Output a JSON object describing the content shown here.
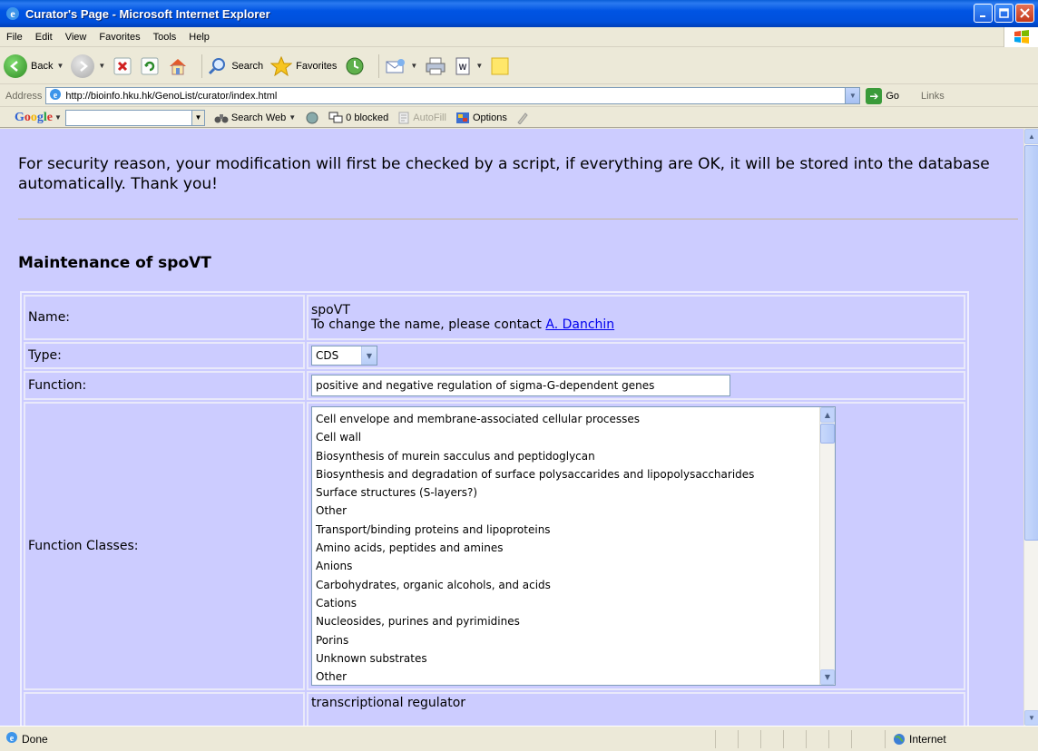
{
  "window": {
    "title": "Curator's Page - Microsoft Internet Explorer"
  },
  "menu": [
    {
      "label": "File"
    },
    {
      "label": "Edit"
    },
    {
      "label": "View"
    },
    {
      "label": "Favorites"
    },
    {
      "label": "Tools"
    },
    {
      "label": "Help"
    }
  ],
  "toolbar": {
    "back_label": "Back",
    "search_label": "Search",
    "favorites_label": "Favorites"
  },
  "address": {
    "label": "Address",
    "url": "http://bioinfo.hku.hk/GenoList/curator/index.html",
    "go_label": "Go",
    "links_label": "Links"
  },
  "google": {
    "logo": "Google",
    "search_web_label": "Search Web",
    "blocked_label": "0 blocked",
    "autofill_label": "AutoFill",
    "options_label": "Options"
  },
  "content": {
    "notice": "For security reason, your modification will first be checked by a script, if everything are OK, it will be stored into the database automatically. Thank you!",
    "heading": "Maintenance of spoVT",
    "name_label": "Name:",
    "name_value": "spoVT",
    "name_note": "To change the name, please contact ",
    "contact_link": "A. Danchin",
    "type_label": "Type:",
    "type_value": "CDS",
    "function_label": "Function:",
    "function_value": "positive and negative regulation of sigma-G-dependent genes",
    "function_classes_label": "Function Classes:",
    "function_classes": [
      "Cell envelope and membrane-associated cellular processes",
      "Cell wall",
      "Biosynthesis of murein sacculus and peptidoglycan",
      "Biosynthesis and degradation of surface polysaccarides and lipopolysaccharides",
      "Surface structures (S-layers?)",
      "Other",
      "Transport/binding proteins and lipoproteins",
      "Amino acids, peptides and amines",
      "Anions",
      "Carbohydrates, organic alcohols, and acids",
      "Cations",
      "Nucleosides, purines and pyrimidines",
      "Porins",
      "Unknown substrates",
      "Other"
    ],
    "next_row_value": "transcriptional regulator"
  },
  "status": {
    "text": "Done",
    "zone": "Internet"
  },
  "colors": {
    "page_background": "#ccccff",
    "link": "#0000ee"
  }
}
